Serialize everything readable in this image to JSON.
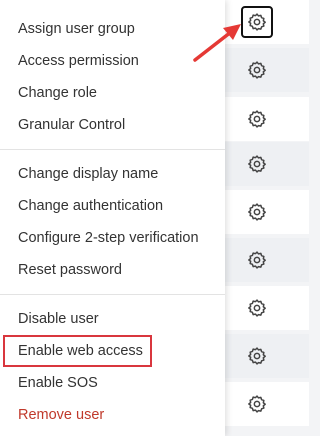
{
  "menu": {
    "items": [
      {
        "label": "Assign user group"
      },
      {
        "label": "Access permission"
      },
      {
        "label": "Change role"
      },
      {
        "label": "Granular Control"
      },
      {
        "label": "Change display name"
      },
      {
        "label": "Change authentication"
      },
      {
        "label": "Configure 2-step verification"
      },
      {
        "label": "Reset password"
      },
      {
        "label": "Disable user"
      },
      {
        "label": "Enable web access"
      },
      {
        "label": "Enable SOS"
      },
      {
        "label": "Remove user"
      }
    ]
  },
  "annotation": {
    "highlighted_item": "Enable web access",
    "highlight_color": "#d9363e",
    "arrow_color": "#e53935"
  },
  "colors": {
    "danger_text": "#c0392b",
    "row_white": "#ffffff",
    "row_grey": "#eef0f3"
  },
  "rows": {
    "icon": "gear-icon"
  }
}
